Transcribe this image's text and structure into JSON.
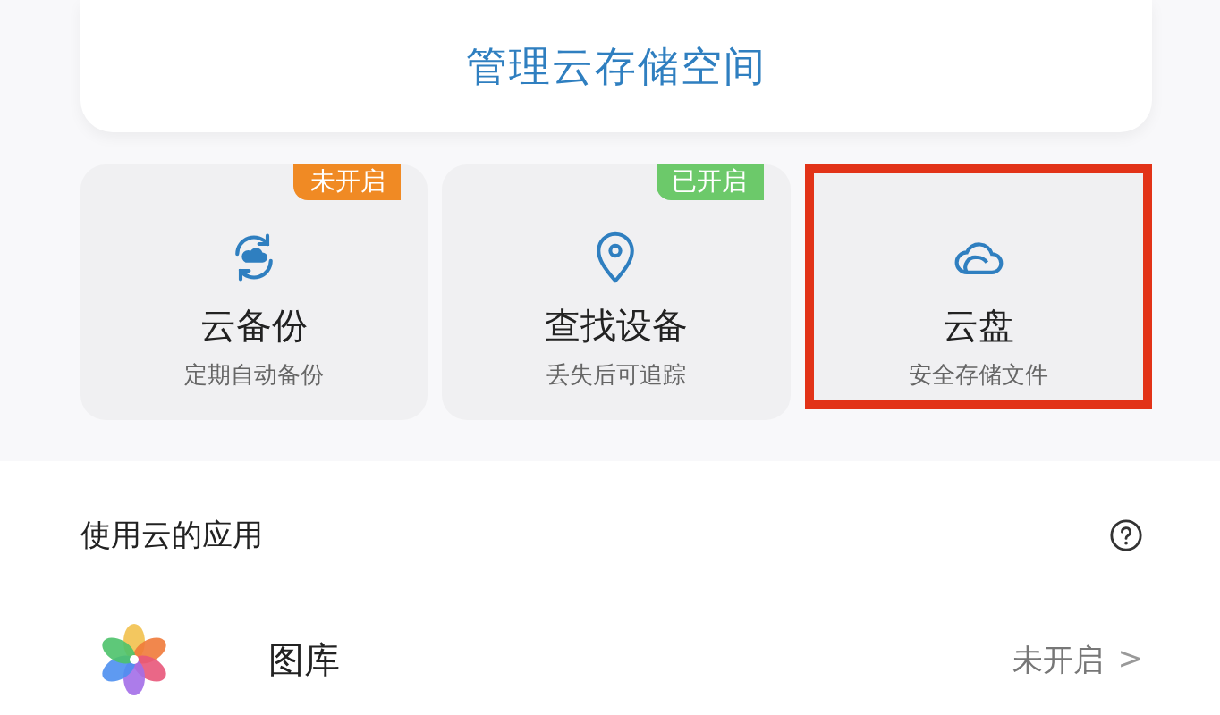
{
  "storage_card": {
    "link": "管理云存储空间"
  },
  "tiles": [
    {
      "kind": "backup",
      "title": "云备份",
      "subtitle": "定期自动备份",
      "badge": {
        "text": "未开启",
        "color": "#f08a24"
      },
      "highlighted": false
    },
    {
      "kind": "find",
      "title": "查找设备",
      "subtitle": "丢失后可追踪",
      "badge": {
        "text": "已开启",
        "color": "#6cc96a"
      },
      "highlighted": false
    },
    {
      "kind": "drive",
      "title": "云盘",
      "subtitle": "安全存储文件",
      "highlighted": true
    }
  ],
  "apps_section": {
    "title": "使用云的应用",
    "items": [
      {
        "name": "图库",
        "status": "未开启",
        "chevron": ">"
      }
    ]
  }
}
